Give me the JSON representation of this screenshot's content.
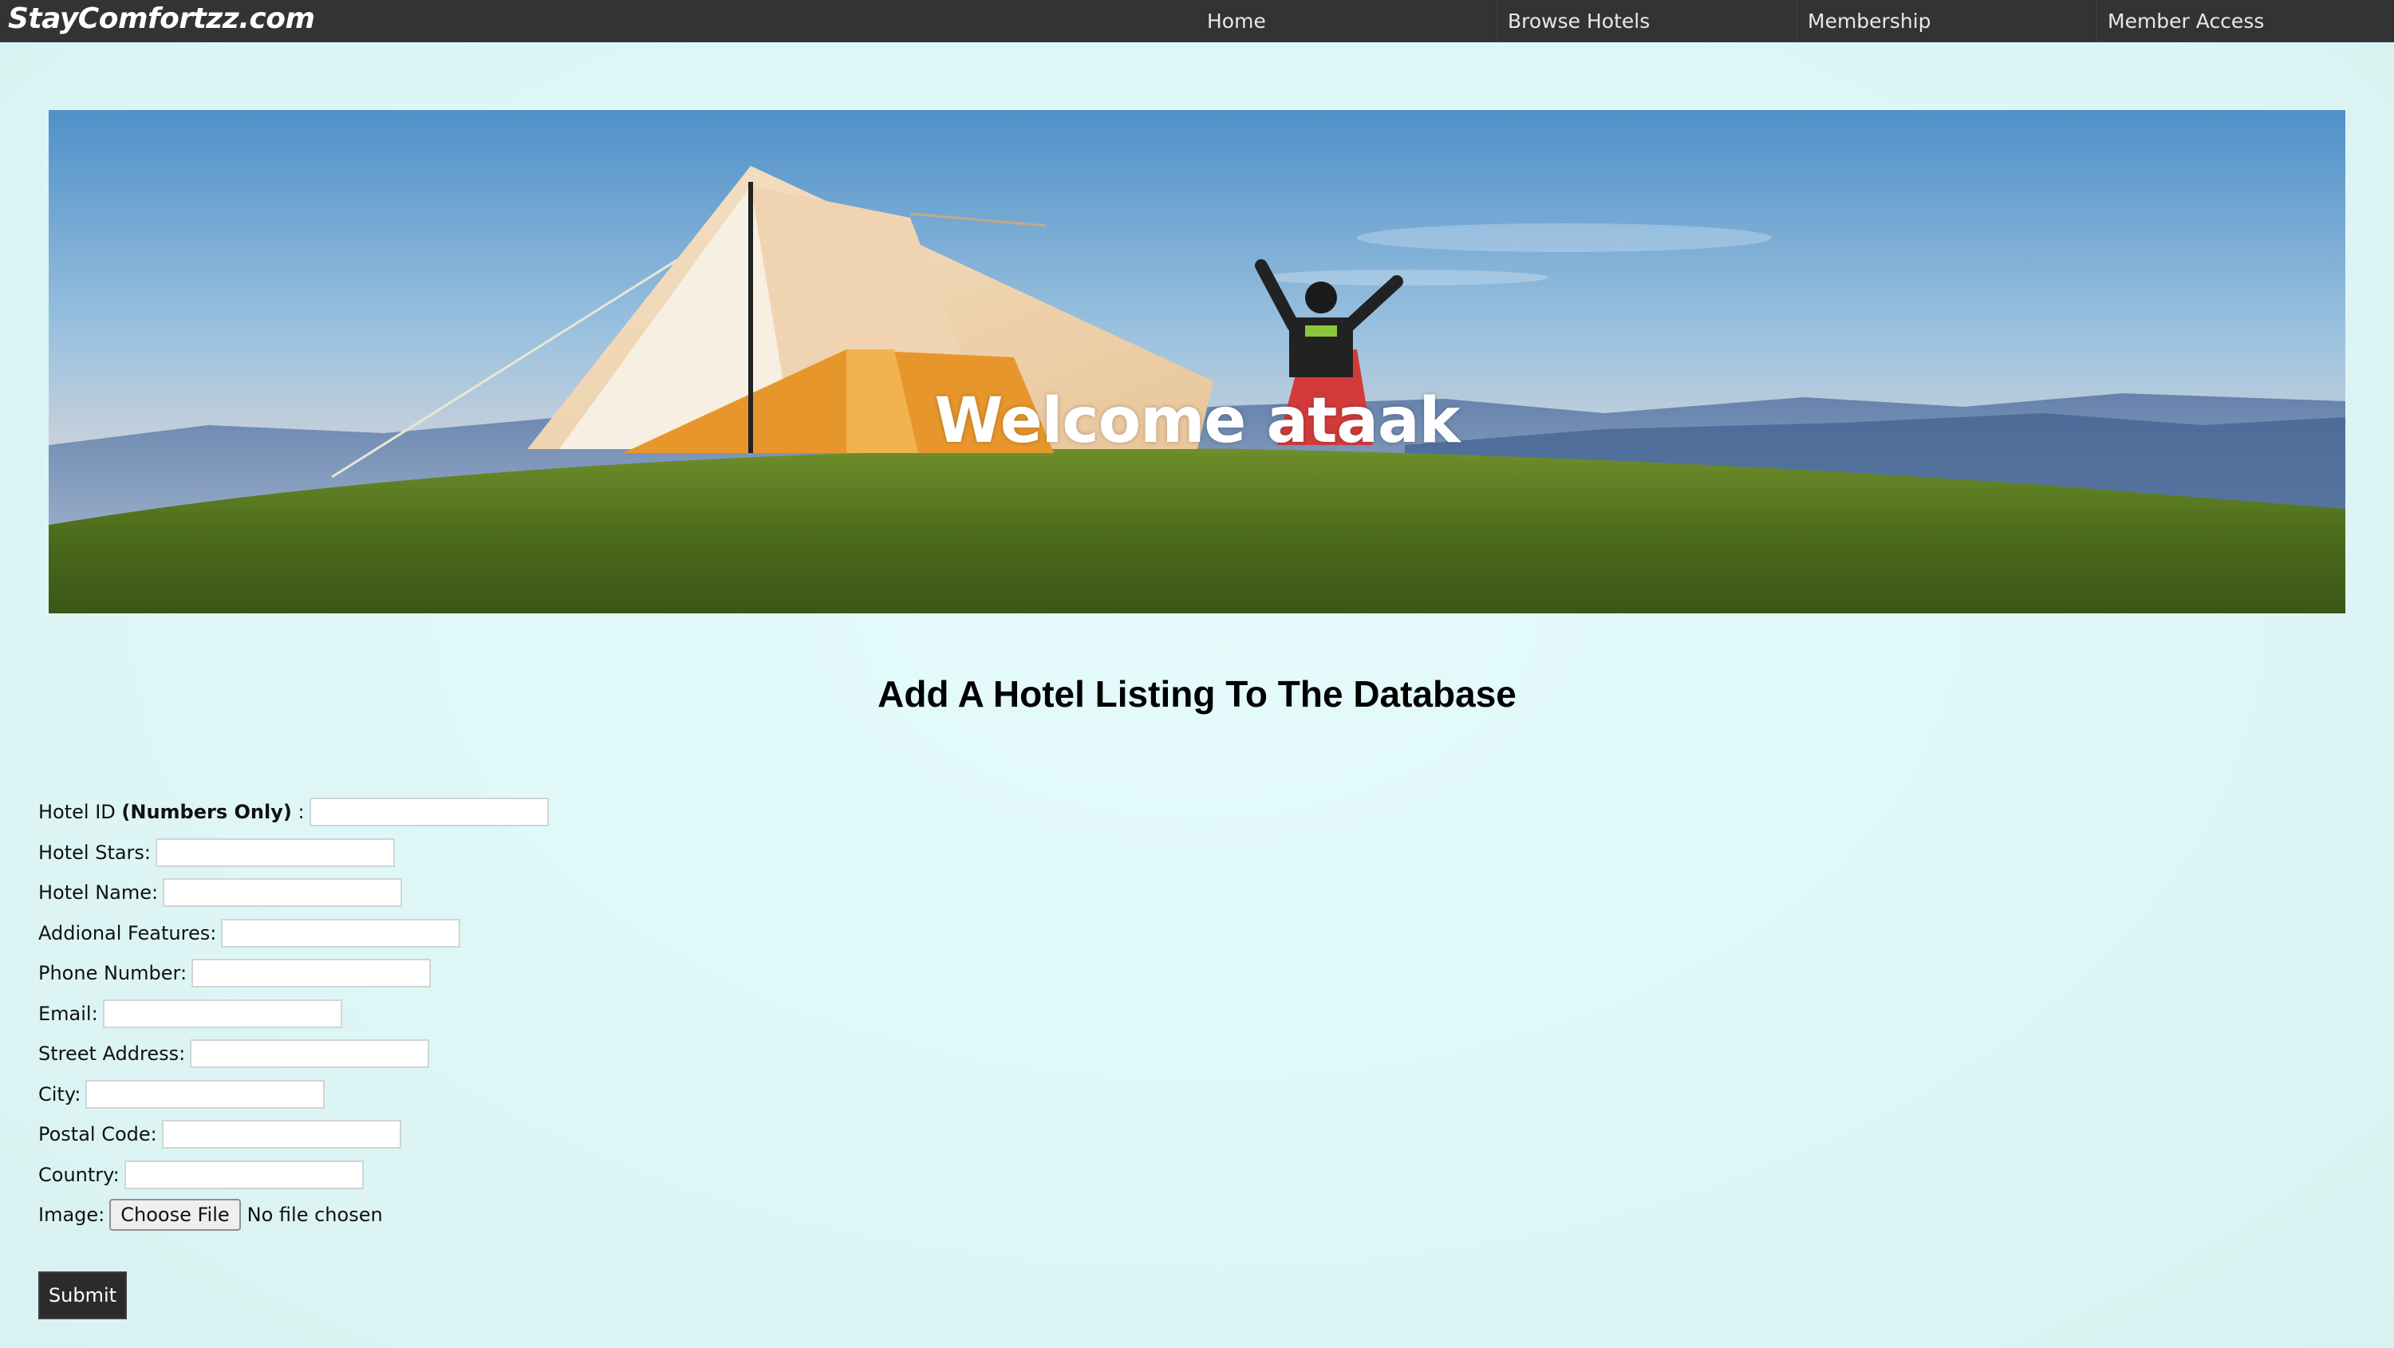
{
  "navbar": {
    "brand": "StayComfortzz.com",
    "items": [
      {
        "label": "Home"
      },
      {
        "label": "Browse Hotels"
      },
      {
        "label": "Membership"
      },
      {
        "label": "Member Access"
      }
    ]
  },
  "hero": {
    "title": "Welcome ataak",
    "image": "camping tent on grassy hill with mountains"
  },
  "form": {
    "heading": "Add A Hotel Listing To The Database",
    "fields": {
      "hotel_id": {
        "label": "Hotel ID",
        "hint": "(Numbers Only)",
        "suffix": ":",
        "value": ""
      },
      "hotel_stars": {
        "label": "Hotel Stars:",
        "value": ""
      },
      "hotel_name": {
        "label": "Hotel Name:",
        "value": ""
      },
      "additional_features": {
        "label": "Addional Features:",
        "value": ""
      },
      "phone_number": {
        "label": "Phone Number:",
        "value": ""
      },
      "email": {
        "label": "Email:",
        "value": ""
      },
      "street_address": {
        "label": "Street Address:",
        "value": ""
      },
      "city": {
        "label": "City:",
        "value": ""
      },
      "postal_code": {
        "label": "Postal Code:",
        "value": ""
      },
      "country": {
        "label": "Country:",
        "value": ""
      }
    },
    "image": {
      "label": "Image:",
      "button": "Choose File",
      "status": "No file chosen"
    },
    "submit": "Submit"
  },
  "colors": {
    "navbar_bg": "#333333",
    "page_bg": "#e0f8f8",
    "submit_bg": "#2b2b2b"
  }
}
